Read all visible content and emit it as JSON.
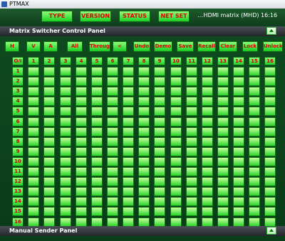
{
  "window": {
    "title": "PTMAX"
  },
  "top_tabs": [
    "TYPE",
    "VERSION",
    "STATUS",
    "NET SET"
  ],
  "device_info": "HDMI matrix (MHD) 16:16",
  "matrix_panel": {
    "title": "Matrix Switcher Control Panel"
  },
  "function_buttons": [
    "H",
    "V",
    "A",
    "All",
    "Through",
    "<",
    "Undo",
    "Demo",
    "Save",
    "Recall",
    "Clear",
    "Lock",
    "Unlock"
  ],
  "grid": {
    "corner_label": "O/I",
    "columns": [
      "1",
      "2",
      "3",
      "4",
      "5",
      "6",
      "7",
      "8",
      "9",
      "10",
      "11",
      "12",
      "13",
      "14",
      "15",
      "16"
    ],
    "rows": [
      "1",
      "2",
      "3",
      "4",
      "5",
      "6",
      "7",
      "8",
      "9",
      "10",
      "11",
      "12",
      "13",
      "14",
      "15",
      "16"
    ]
  },
  "manual_panel": {
    "title": "Manual Sender Panel"
  },
  "colors": {
    "button_text": "#d80000",
    "button_green": "#1ac922",
    "panel_bg": "#0b3f1a"
  }
}
